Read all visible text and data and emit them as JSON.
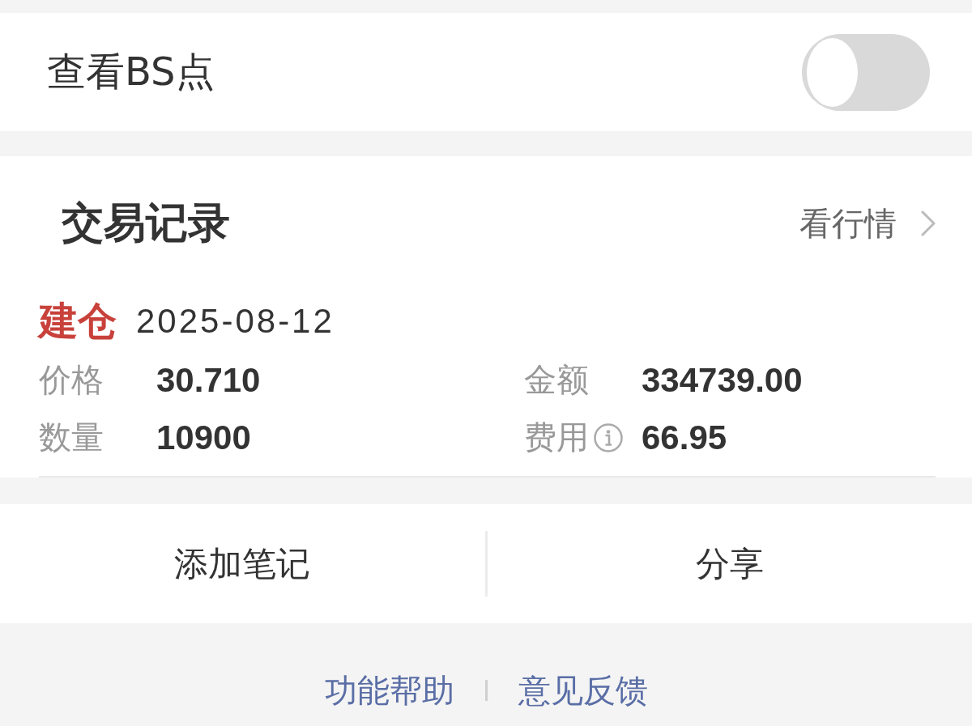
{
  "settings": {
    "label": "查看BS点",
    "toggle": {
      "on": false
    }
  },
  "trade_records": {
    "title": "交易记录",
    "market_link": {
      "label": "看行情"
    },
    "entries": [
      {
        "action": "建仓",
        "kind": "open",
        "date": "2025-08-12",
        "fields": [
          {
            "label": "价格",
            "value": "30.710"
          },
          {
            "label": "金额",
            "value": "334739.00"
          },
          {
            "label": "数量",
            "value": "10900"
          },
          {
            "label": "费用",
            "value": "66.95",
            "info": true
          }
        ]
      }
    ]
  },
  "actions": [
    {
      "label": "添加笔记"
    },
    {
      "label": "分享"
    }
  ],
  "footer_links": [
    {
      "label": "功能帮助"
    },
    {
      "label": "意见反馈"
    }
  ]
}
